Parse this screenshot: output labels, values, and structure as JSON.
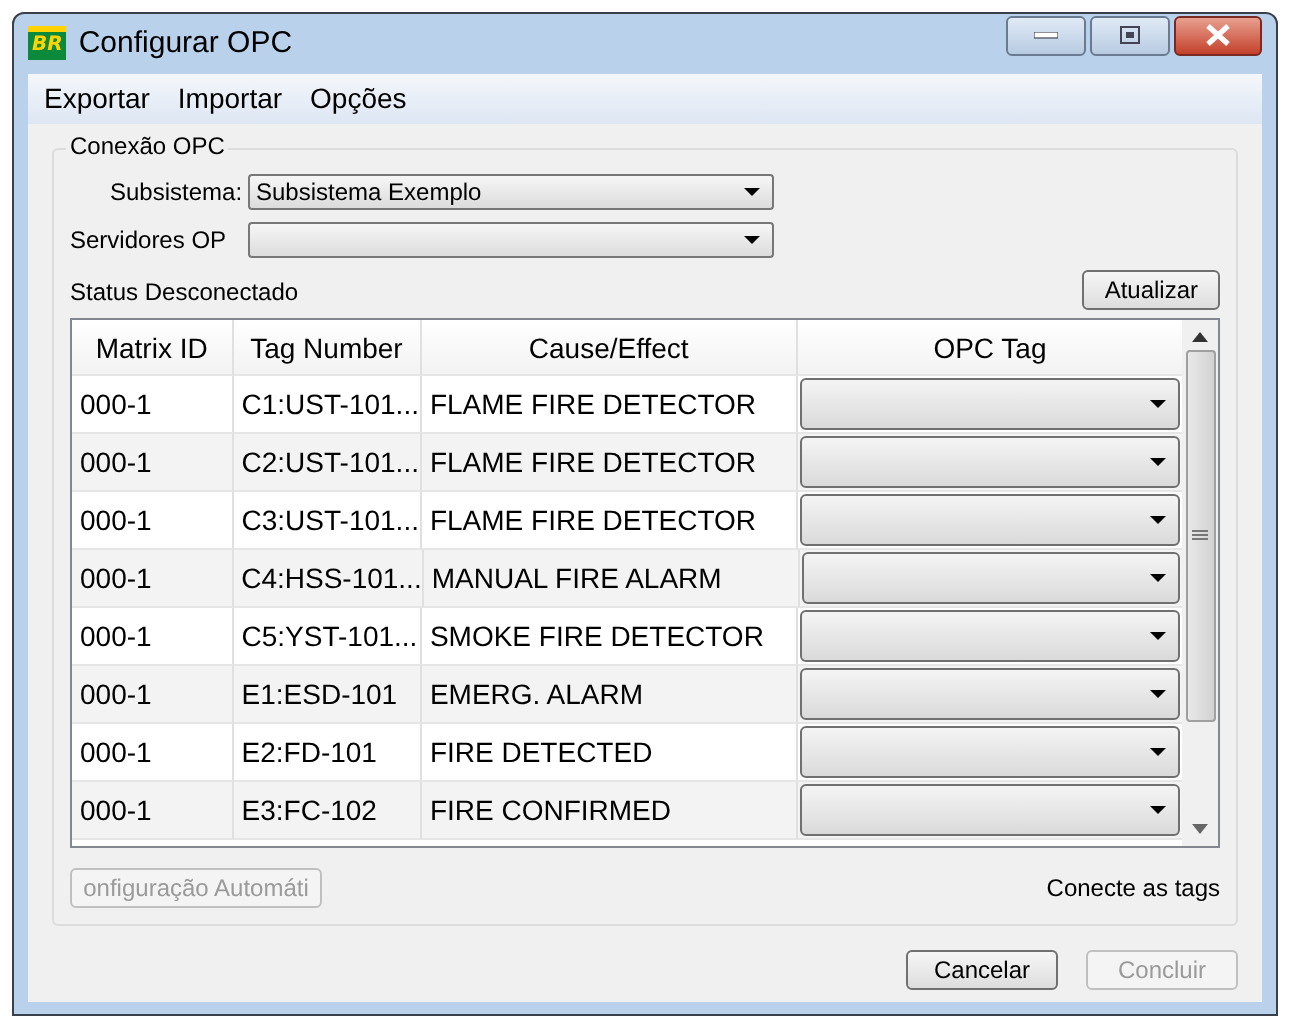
{
  "window": {
    "title": "Configurar OPC",
    "logo": "BR"
  },
  "menu": [
    "Exportar",
    "Importar",
    "Opções"
  ],
  "group": {
    "title": "Conexão OPC",
    "subsistema": {
      "label": "Subsistema:",
      "value": "Subsistema Exemplo"
    },
    "servidores": {
      "label": "Servidores OP"
    },
    "status": "Status Desconectado",
    "refresh_button": "Atualizar"
  },
  "table": {
    "columns": [
      "Matrix ID",
      "Tag Number",
      "Cause/Effect",
      "OPC Tag"
    ],
    "rows": [
      {
        "matrix_id": "000-1",
        "tag": "C1:UST-101...",
        "cause_effect": "FLAME FIRE DETECTOR"
      },
      {
        "matrix_id": "000-1",
        "tag": "C2:UST-101...",
        "cause_effect": "FLAME FIRE DETECTOR"
      },
      {
        "matrix_id": "000-1",
        "tag": "C3:UST-101...",
        "cause_effect": "FLAME FIRE DETECTOR"
      },
      {
        "matrix_id": "000-1",
        "tag": "C4:HSS-101...",
        "cause_effect": "MANUAL FIRE ALARM"
      },
      {
        "matrix_id": "000-1",
        "tag": "C5:YST-101...",
        "cause_effect": "SMOKE FIRE DETECTOR"
      },
      {
        "matrix_id": "000-1",
        "tag": "E1:ESD-101",
        "cause_effect": "EMERG. ALARM"
      },
      {
        "matrix_id": "000-1",
        "tag": "E2:FD-101",
        "cause_effect": "FIRE DETECTED"
      },
      {
        "matrix_id": "000-1",
        "tag": "E3:FC-102",
        "cause_effect": "FIRE CONFIRMED"
      }
    ]
  },
  "auto_config_button": {
    "label": "onfiguração Automáti",
    "disabled": true
  },
  "hint": "Conecte as tags",
  "buttons": [
    {
      "label": "Cancelar",
      "disabled": false
    },
    {
      "label": "Concluir",
      "disabled": true
    }
  ]
}
